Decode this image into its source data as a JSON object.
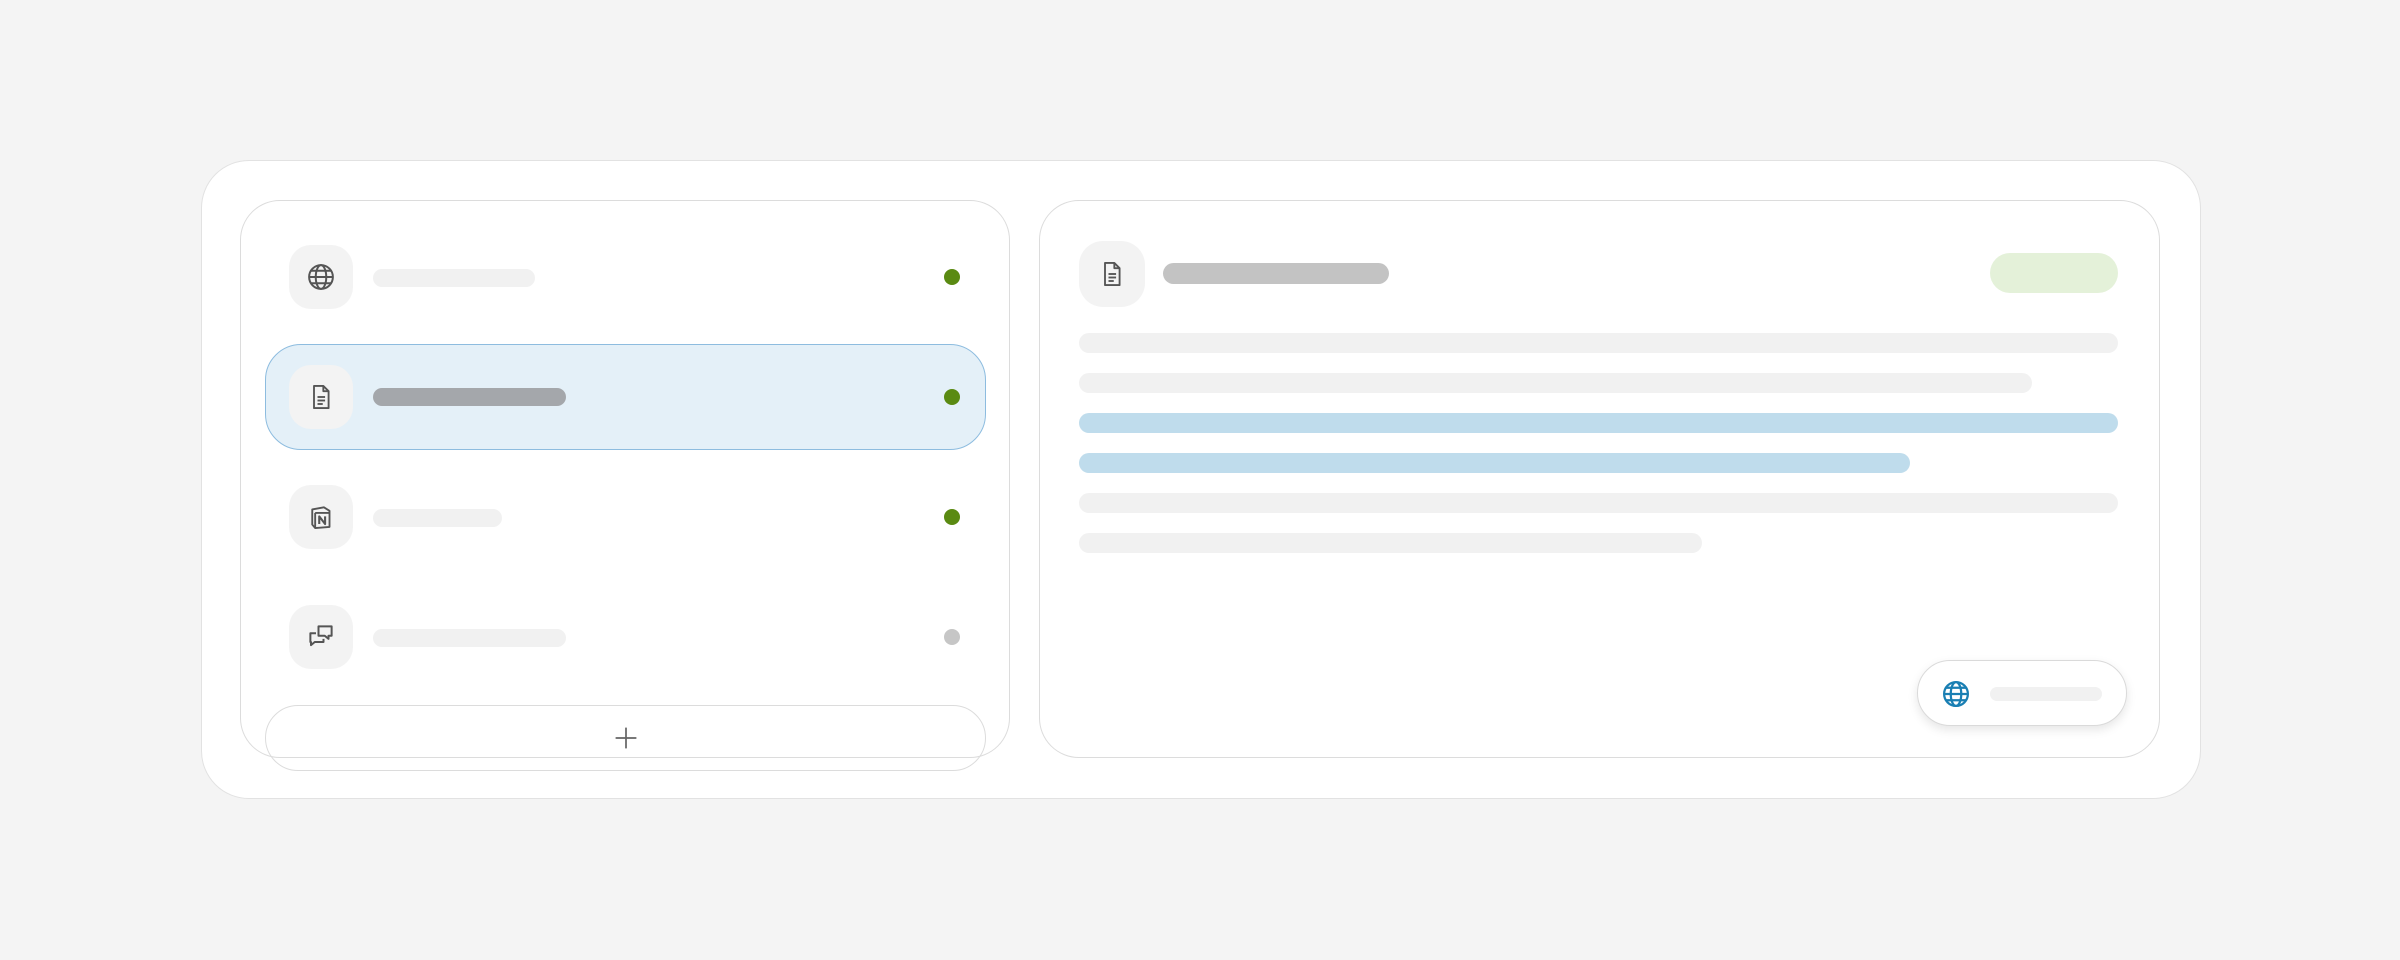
{
  "sources": [
    {
      "icon": "globe-icon",
      "status": "connected",
      "selected": false
    },
    {
      "icon": "document-icon",
      "status": "connected",
      "selected": true
    },
    {
      "icon": "notion-icon",
      "status": "connected",
      "selected": false
    },
    {
      "icon": "chat-bubbles-icon",
      "status": "inactive",
      "selected": false
    }
  ],
  "colors": {
    "status_connected": "#5a8a12",
    "status_inactive": "#c6c6c6",
    "selected_background": "#e4f0f8",
    "selected_border": "#8dbcdf",
    "highlight_line": "#bfdcec",
    "placeholder_line": "#f1f1f1",
    "title_placeholder": "#c3c3c3",
    "status_pill": "#e4f1d9",
    "chip_icon": "#1a7fb3",
    "icon_stroke": "#555555"
  },
  "add_button": {
    "icon": "plus-icon"
  },
  "detail": {
    "icon": "document-icon",
    "text_lines": [
      {
        "highlighted": false
      },
      {
        "highlighted": false
      },
      {
        "highlighted": true
      },
      {
        "highlighted": true
      },
      {
        "highlighted": false
      },
      {
        "highlighted": false
      }
    ]
  },
  "floating_chip": {
    "icon": "globe-icon"
  }
}
